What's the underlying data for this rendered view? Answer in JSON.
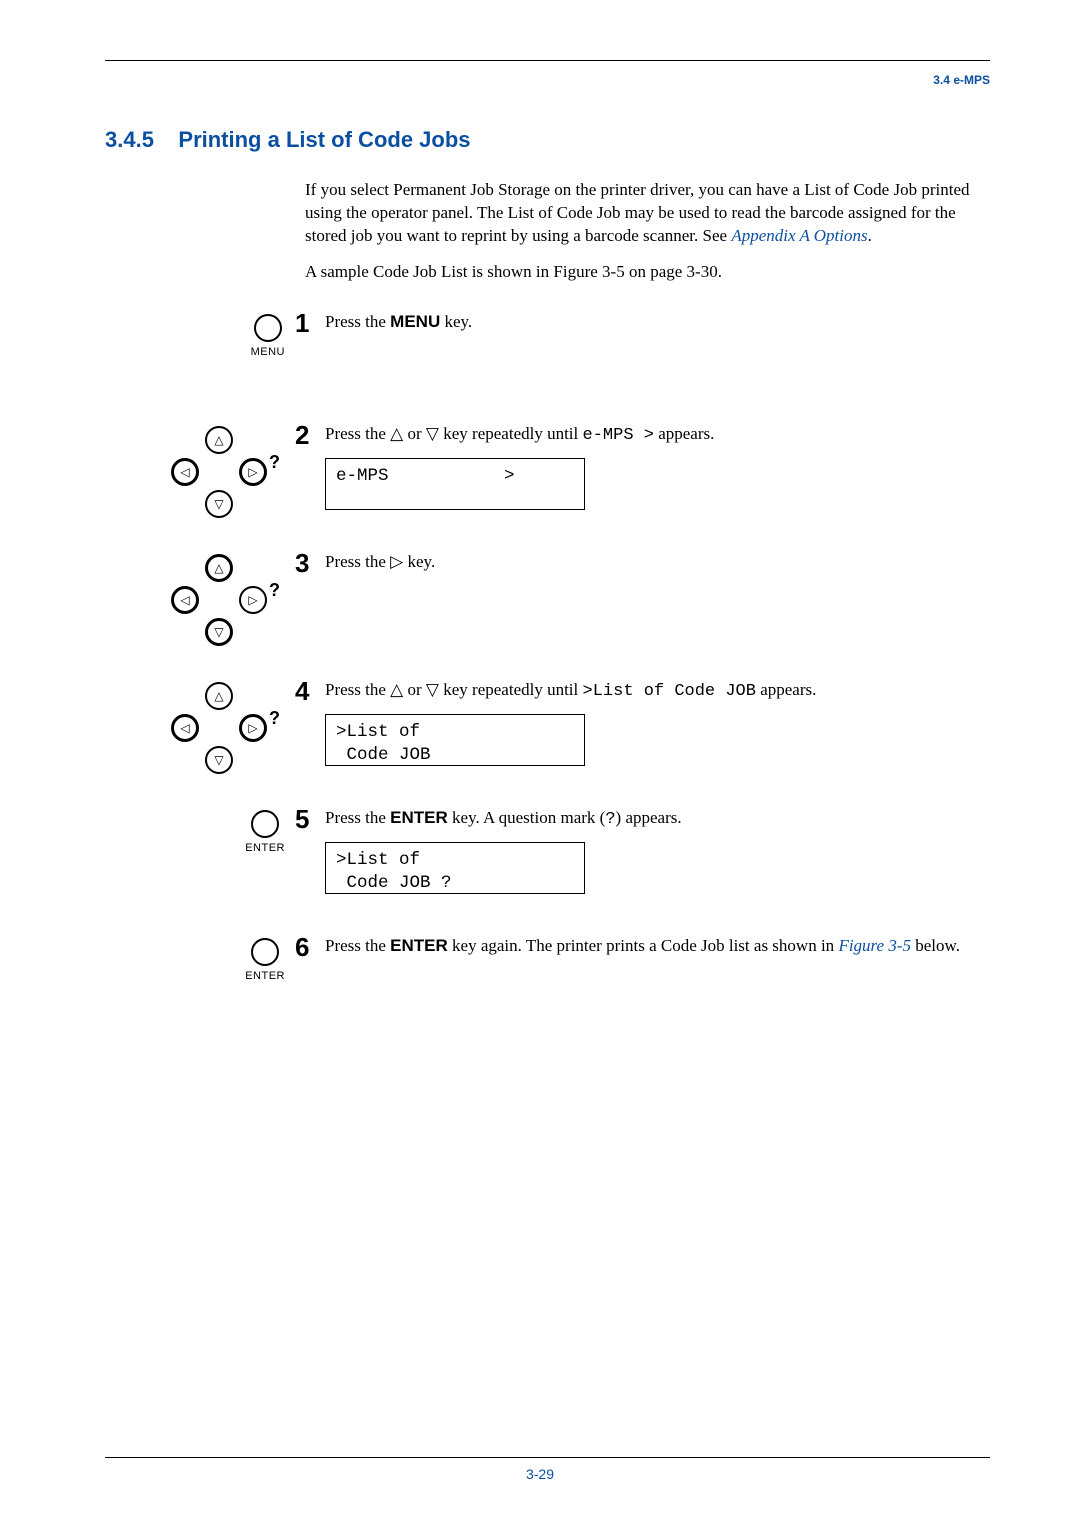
{
  "header_rule": true,
  "running_head": "3.4 e-MPS",
  "section_number": "3.4.5",
  "section_title_text": "Printing a List of Code Jobs",
  "intro_pre": "If you select Permanent Job Storage on the printer driver, you can have a List of Code Job printed using the operator panel. The List of Code Job may be used to read the barcode assigned for the stored job you want to reprint by using a barcode scanner. See ",
  "intro_link1": "Appendix A Options",
  "intro_post": ".",
  "sample_pre": "A sample Code Job List is shown in ",
  "sample_link": "Figure 3-5 on page 3-30",
  "sample_post": ".",
  "steps": {
    "s1": {
      "num": "1",
      "text_pre": "Press the ",
      "bold": "MENU",
      "text_post": " key."
    },
    "s2": {
      "num": "2",
      "text_pre": "Press the ",
      "tri1": "△",
      "or": " or ",
      "tri2": "▽",
      "text_mid": " key repeatedly until ",
      "mono": "e-MPS  >",
      "text_post": " appears.",
      "lcd": "e-MPS           >\n"
    },
    "s3": {
      "num": "3",
      "text_pre": "Press the ",
      "tri": "▷",
      "text_post": " key."
    },
    "s4": {
      "num": "4",
      "text_pre": "Press the ",
      "tri1": "△",
      "or": " or ",
      "tri2": "▽",
      "text_mid": " key repeatedly until ",
      "mono": ">List of Code JOB",
      "text_post": " appears.",
      "lcd": ">List of\n Code JOB"
    },
    "s5": {
      "num": "5",
      "text_pre": "Press the ",
      "bold": "ENTER",
      "text_mid": " key. A question mark (",
      "mono": "?",
      "text_post": ") appears.",
      "lcd": ">List of\n Code JOB ?"
    },
    "s6": {
      "num": "6",
      "text_pre": "Press the ",
      "bold": "ENTER",
      "text_mid": " key again. The printer prints a Code Job list as shown in ",
      "link": "Figure 3-5",
      "text_post": " below."
    }
  },
  "key_labels": {
    "menu": "MENU",
    "enter": "ENTER"
  },
  "page_number": "3-29"
}
